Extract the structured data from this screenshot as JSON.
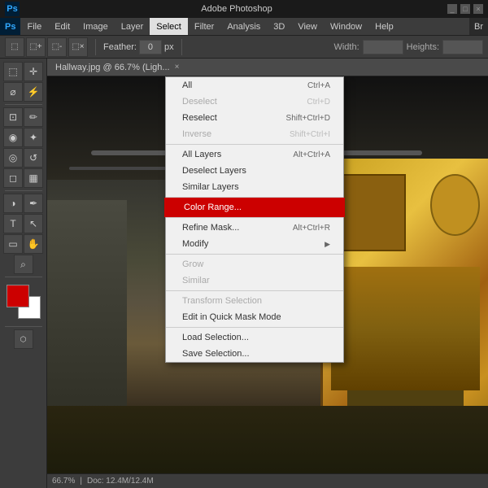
{
  "app": {
    "title": "Adobe Photoshop",
    "ps_logo": "Ps",
    "version_label": "Br"
  },
  "title_bar": {
    "text": "Adobe Photoshop"
  },
  "menu_bar": {
    "items": [
      {
        "id": "ps",
        "label": "Ps"
      },
      {
        "id": "file",
        "label": "File"
      },
      {
        "id": "edit",
        "label": "Edit"
      },
      {
        "id": "image",
        "label": "Image"
      },
      {
        "id": "layer",
        "label": "Layer"
      },
      {
        "id": "select",
        "label": "Select"
      },
      {
        "id": "filter",
        "label": "Filter"
      },
      {
        "id": "analysis",
        "label": "Analysis"
      },
      {
        "id": "3d",
        "label": "3D"
      },
      {
        "id": "view",
        "label": "View"
      },
      {
        "id": "window",
        "label": "Window"
      },
      {
        "id": "help",
        "label": "Help"
      }
    ]
  },
  "options_bar": {
    "feather_label": "Feather:",
    "feather_value": "0"
  },
  "canvas": {
    "tab_label": "Hallway.jpg @ 66.7% (Ligh..."
  },
  "select_menu": {
    "items": [
      {
        "id": "all",
        "label": "All",
        "shortcut": "Ctrl+A",
        "disabled": false
      },
      {
        "id": "deselect",
        "label": "Deselect",
        "shortcut": "Ctrl+D",
        "disabled": true
      },
      {
        "id": "reselect",
        "label": "Reselect",
        "shortcut": "Shift+Ctrl+D",
        "disabled": false
      },
      {
        "id": "inverse",
        "label": "Inverse",
        "shortcut": "Shift+Ctrl+I",
        "disabled": true
      },
      {
        "id": "sep1",
        "type": "separator"
      },
      {
        "id": "all_layers",
        "label": "All Layers",
        "shortcut": "Alt+Ctrl+A",
        "disabled": false
      },
      {
        "id": "deselect_layers",
        "label": "Deselect Layers",
        "shortcut": "",
        "disabled": false
      },
      {
        "id": "similar_layers",
        "label": "Similar Layers",
        "shortcut": "",
        "disabled": false
      },
      {
        "id": "sep2",
        "type": "separator"
      },
      {
        "id": "color_range",
        "label": "Color Range...",
        "shortcut": "",
        "disabled": false,
        "highlighted": true
      },
      {
        "id": "sep3",
        "type": "separator"
      },
      {
        "id": "refine_mask",
        "label": "Refine Mask...",
        "shortcut": "Alt+Ctrl+R",
        "disabled": false
      },
      {
        "id": "modify",
        "label": "Modify",
        "shortcut": "",
        "disabled": false,
        "submenu": true
      },
      {
        "id": "sep4",
        "type": "separator"
      },
      {
        "id": "grow",
        "label": "Grow",
        "shortcut": "",
        "disabled": true
      },
      {
        "id": "similar",
        "label": "Similar",
        "shortcut": "",
        "disabled": true
      },
      {
        "id": "sep5",
        "type": "separator"
      },
      {
        "id": "transform_selection",
        "label": "Transform Selection",
        "shortcut": "",
        "disabled": true
      },
      {
        "id": "quick_mask",
        "label": "Edit in Quick Mask Mode",
        "shortcut": "",
        "disabled": false
      },
      {
        "id": "sep6",
        "type": "separator"
      },
      {
        "id": "load_selection",
        "label": "Load Selection...",
        "shortcut": "",
        "disabled": false
      },
      {
        "id": "save_selection",
        "label": "Save Selection...",
        "shortcut": "",
        "disabled": false
      }
    ]
  },
  "toolbar": {
    "tools": [
      {
        "id": "marquee",
        "icon": "⬚"
      },
      {
        "id": "move",
        "icon": "✛"
      },
      {
        "id": "lasso",
        "icon": "⌀"
      },
      {
        "id": "magic-wand",
        "icon": "⚡"
      },
      {
        "id": "crop",
        "icon": "⊡"
      },
      {
        "id": "eyedropper",
        "icon": "✏"
      },
      {
        "id": "spot-heal",
        "icon": "◉"
      },
      {
        "id": "brush",
        "icon": "✦"
      },
      {
        "id": "clone",
        "icon": "◎"
      },
      {
        "id": "history-brush",
        "icon": "↺"
      },
      {
        "id": "eraser",
        "icon": "◻"
      },
      {
        "id": "gradient",
        "icon": "▦"
      },
      {
        "id": "dodge",
        "icon": "◑"
      },
      {
        "id": "pen",
        "icon": "✒"
      },
      {
        "id": "type",
        "icon": "T"
      },
      {
        "id": "path-select",
        "icon": "↖"
      },
      {
        "id": "shape",
        "icon": "▭"
      },
      {
        "id": "hand",
        "icon": "✋"
      },
      {
        "id": "zoom",
        "icon": "⌕"
      }
    ]
  },
  "status_bar": {
    "zoom": "66.7%",
    "doc_size": "Doc: 12.4M/12.4M"
  }
}
